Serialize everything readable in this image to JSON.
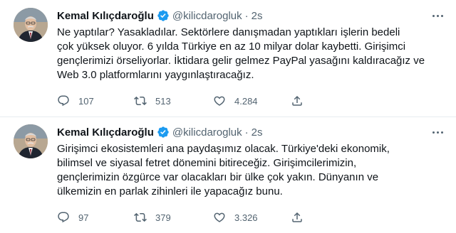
{
  "tweets": [
    {
      "author": "Kemal Kılıçdaroğlu",
      "handle": "@kilicdarogluk",
      "separator": "·",
      "time": "2s",
      "lines": [
        "Ne yaptılar? Yasakladılar. Sektörlere danışmadan yaptıkları işlerin bedeli",
        "çok yüksek oluyor. 6 yılda Türkiye en az 10 milyar dolar kaybetti. Girişimci",
        "gençlerimizi örseliyorlar. İktidara gelir gelmez PayPal yasağını kaldıracağız ve",
        "Web 3.0 platformlarını yaygınlaştıracağız."
      ],
      "replies": "107",
      "retweets": "513",
      "likes": "4.284"
    },
    {
      "author": "Kemal Kılıçdaroğlu",
      "handle": "@kilicdarogluk",
      "separator": "·",
      "time": "2s",
      "lines": [
        "Girişimci ekosistemleri ana paydaşımız olacak. Türkiye'deki ekonomik,",
        "bilimsel ve siyasal fetret dönemini bitireceğiz. Girişimcilerimizin,",
        "gençlerimizin özgürce var olacakları bir ülke çok yakın. Dünyanın ve",
        "ülkemizin en parlak zihinleri ile yapacağız bunu."
      ],
      "replies": "97",
      "retweets": "379",
      "likes": "3.326"
    }
  ],
  "icons": {
    "verified": "verified-badge-icon",
    "more": "more-options-icon",
    "reply": "reply-icon",
    "retweet": "retweet-icon",
    "like": "heart-icon",
    "share": "share-icon"
  },
  "colors": {
    "verified": "#1d9bf0",
    "secondary_text": "#536471",
    "primary_text": "#0f1419"
  }
}
